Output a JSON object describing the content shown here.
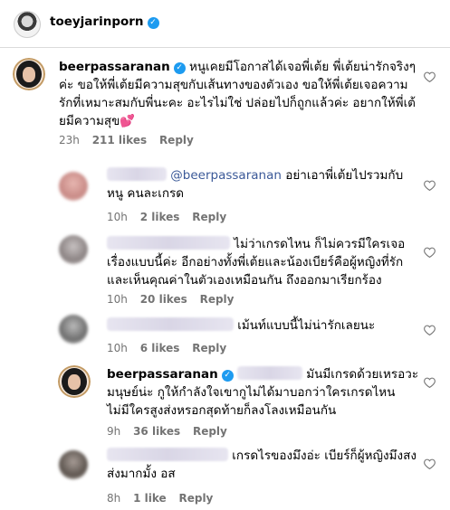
{
  "header": {
    "username": "toeyjarinporn",
    "verified_glyph": "✓"
  },
  "comments": [
    {
      "username": "beerpassaranan",
      "text": "หนูเคยมีโอกาสได้เจอพี่เต้ย พี่เต้ยน่ารักจริงๆค่ะ ขอให้พี่เต้ยมีความสุขกับเส้นทางของตัวเอง ขอให้พี่เต้ยเจอความรักที่เหมาะสมกับพี่นะคะ อะไรไม่ใช่ ปล่อยไปก็ถูกแล้วค่ะ อยากให้พี่เต้ยมีความสุข💕",
      "time": "23h",
      "likes": "211 likes",
      "reply": "Reply"
    },
    {
      "mention": "@beerpassaranan",
      "text": "อย่าเอาพี่เต้ยไปรวมกับ หนู คนละเกรด",
      "time": "10h",
      "likes": "2 likes",
      "reply": "Reply"
    },
    {
      "text": "ไม่ว่าเกรดไหน ก็ไม่ควรมีใครเจอเรื่องแบบนี้ค่ะ อีกอย่างทั้งพี่เต้ยและน้องเบียร์คือผู้หญิงที่รักและเห็นคุณค่าในตัวเองเหมือนกัน ถึงออกมาเรียกร้อง",
      "time": "10h",
      "likes": "20 likes",
      "reply": "Reply"
    },
    {
      "text": "เม้นท์แบบนี้ไม่น่ารักเลยนะ",
      "time": "10h",
      "likes": "6 likes",
      "reply": "Reply"
    },
    {
      "username": "beerpassaranan",
      "text": "มันมีเกรดด้วยเหรอวะ มนุษย์น่ะ กูให้กำลังใจเขากูไม่ได้มาบอกว่าใครเกรดไหน ไม่มีใครสูงส่งหรอกสุดท้ายก็ลงโลงเหมือนกัน",
      "time": "9h",
      "likes": "36 likes",
      "reply": "Reply"
    },
    {
      "text": "เกรดไรของมึงอ่ะ เบียร์ก็ผู้หญิงมึงสงส่งมากมั้ง อส",
      "time": "8h",
      "likes": "1 like",
      "reply": "Reply"
    }
  ],
  "colors": {
    "verified": "#1d9bf0",
    "mention": "#3b5998",
    "meta": "#737373"
  },
  "icons": {
    "like": "heart-outline-icon"
  }
}
